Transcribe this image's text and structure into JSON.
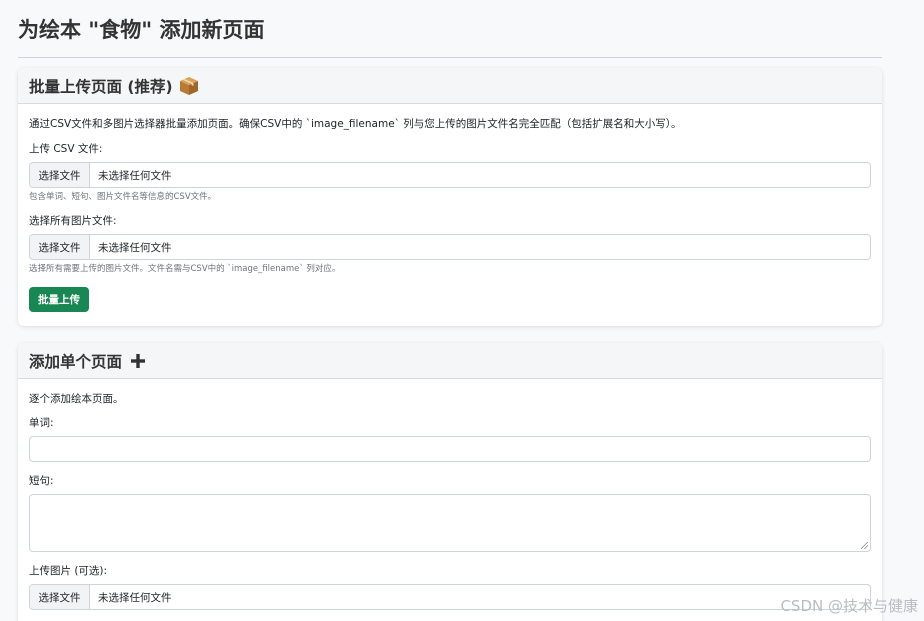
{
  "page": {
    "title": "为绘本 \"食物\" 添加新页面"
  },
  "bulk": {
    "header": "批量上传页面 (推荐)",
    "header_icon": "package-icon",
    "description": "通过CSV文件和多图片选择器批量添加页面。确保CSV中的 `image_filename` 列与您上传的图片文件名完全匹配（包括扩展名和大小写）。",
    "csv_label": "上传 CSV 文件:",
    "csv_button": "选择文件",
    "csv_value": "未选择任何文件",
    "csv_hint": "包含单词、短句、图片文件名等信息的CSV文件。",
    "images_label": "选择所有图片文件:",
    "images_button": "选择文件",
    "images_value": "未选择任何文件",
    "images_hint": "选择所有需要上传的图片文件。文件名需与CSV中的 `image_filename` 列对应。",
    "submit_label": "批量上传"
  },
  "single": {
    "header": "添加单个页面",
    "header_icon": "plus-icon",
    "description": "逐个添加绘本页面。",
    "word_label": "单词:",
    "word_value": "",
    "sentence_label": "短句:",
    "sentence_value": "",
    "image_label": "上传图片 (可选):",
    "image_button": "选择文件",
    "image_value": "未选择任何文件"
  },
  "watermark": "CSDN @技术与健康",
  "colors": {
    "accent_green": "#198754",
    "background": "#f8f9fa"
  }
}
